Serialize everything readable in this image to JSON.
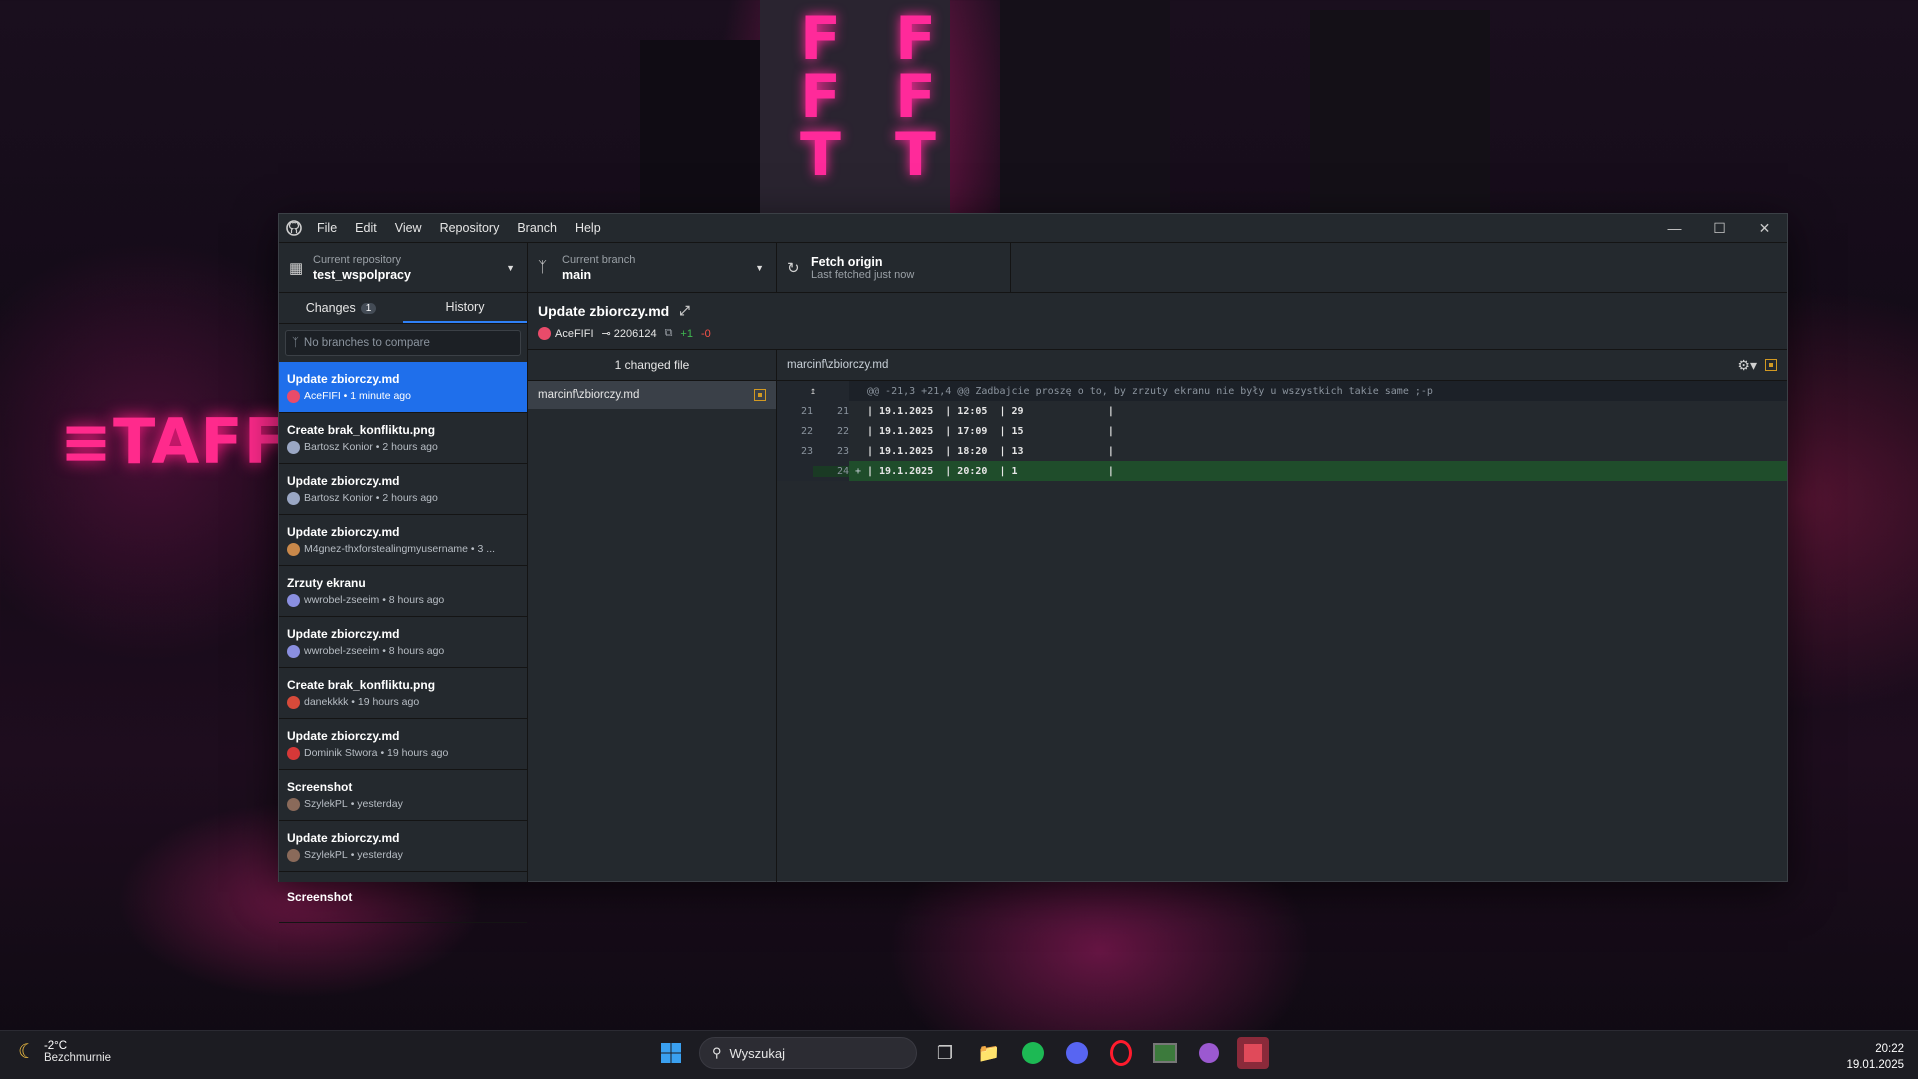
{
  "menu": [
    "File",
    "Edit",
    "View",
    "Repository",
    "Branch",
    "Help"
  ],
  "window_controls": [
    "minimize-icon",
    "maximize-icon",
    "close-icon"
  ],
  "toolbar": {
    "repo_label": "Current repository",
    "repo_name": "test_wspolpracy",
    "branch_label": "Current branch",
    "branch_name": "main",
    "fetch_label": "Fetch origin",
    "fetch_sub": "Last fetched just now"
  },
  "tabs": {
    "changes": "Changes",
    "changes_count": "1",
    "history": "History"
  },
  "compare_placeholder": "No branches to compare",
  "commits": [
    {
      "title": "Update zbiorczy.md",
      "author": "AceFIFI",
      "time": "1 minute ago",
      "color": "#e94b6a"
    },
    {
      "title": "Create brak_konfliktu.png",
      "author": "Bartosz Konior",
      "time": "2 hours ago",
      "color": "#9aa7c4"
    },
    {
      "title": "Update zbiorczy.md",
      "author": "Bartosz Konior",
      "time": "2 hours ago",
      "color": "#9aa7c4"
    },
    {
      "title": "Update zbiorczy.md",
      "author": "M4gnez-thxforstealingmyusername",
      "time": "3 ...",
      "color": "#c9884a"
    },
    {
      "title": "Zrzuty ekranu",
      "author": "wwrobel-zseeim",
      "time": "8 hours ago",
      "color": "#8a8fe0"
    },
    {
      "title": "Update zbiorczy.md",
      "author": "wwrobel-zseeim",
      "time": "8 hours ago",
      "color": "#8a8fe0"
    },
    {
      "title": "Create brak_konfliktu.png",
      "author": "danekkkk",
      "time": "19 hours ago",
      "color": "#d64a3a"
    },
    {
      "title": "Update zbiorczy.md",
      "author": "Dominik Stwora",
      "time": "19 hours ago",
      "color": "#d63838"
    },
    {
      "title": "Screenshot",
      "author": "SzylekPL",
      "time": "yesterday",
      "color": "#8a6a5a"
    },
    {
      "title": "Update zbiorczy.md",
      "author": "SzylekPL",
      "time": "yesterday",
      "color": "#8a6a5a"
    },
    {
      "title": "Screenshot",
      "author": "",
      "time": "",
      "color": "#8a6a5a"
    }
  ],
  "commit_detail": {
    "title": "Update zbiorczy.md",
    "author": "AceFIFI",
    "sha": "2206124",
    "added": "+1",
    "deleted": "-0"
  },
  "files": {
    "header": "1 changed file",
    "items": [
      "marcinf\\zbiorczy.md"
    ]
  },
  "diff": {
    "path": "marcinf\\zbiorczy.md",
    "hunk": "@@ -21,3 +21,4 @@ Zadbajcie proszę o to, by zrzuty ekranu nie były u wszystkich takie same ;-p",
    "lines": [
      {
        "old": "21",
        "new": "21",
        "sign": "",
        "code": "| 19.1.2025  | 12:05  | 29              |",
        "type": "context"
      },
      {
        "old": "22",
        "new": "22",
        "sign": "",
        "code": "| 19.1.2025  | 17:09  | 15              |",
        "type": "context"
      },
      {
        "old": "23",
        "new": "23",
        "sign": "",
        "code": "| 19.1.2025  | 18:20  | 13              |",
        "type": "context"
      },
      {
        "old": "",
        "new": "24",
        "sign": "+",
        "code": "| 19.1.2025  | 20:20  | 1               |",
        "type": "added"
      }
    ]
  },
  "taskbar": {
    "temp": "-2°C",
    "weather": "Bezchmurnie",
    "search": "Wyszukaj",
    "time": "20:22",
    "date": "19.01.2025"
  }
}
